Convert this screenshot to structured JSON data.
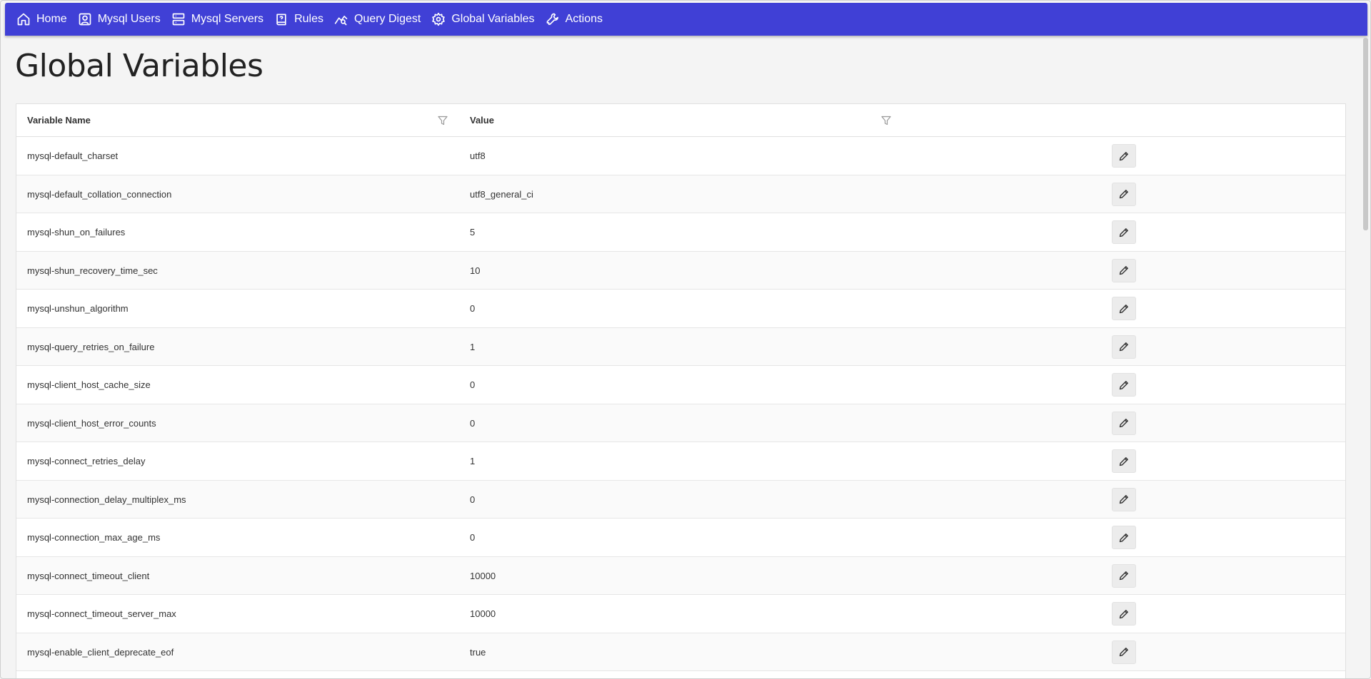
{
  "nav": {
    "items": [
      {
        "label": "Home",
        "icon": "home-icon"
      },
      {
        "label": "Mysql Users",
        "icon": "user-icon"
      },
      {
        "label": "Mysql Servers",
        "icon": "servers-icon"
      },
      {
        "label": "Rules",
        "icon": "rules-icon"
      },
      {
        "label": "Query Digest",
        "icon": "chart-icon"
      },
      {
        "label": "Global Variables",
        "icon": "gear-icon"
      },
      {
        "label": "Actions",
        "icon": "wrench-icon"
      }
    ]
  },
  "page": {
    "title": "Global Variables"
  },
  "table": {
    "columns": {
      "name": "Variable Name",
      "value": "Value"
    },
    "rows": [
      {
        "name": "mysql-default_charset",
        "value": "utf8"
      },
      {
        "name": "mysql-default_collation_connection",
        "value": "utf8_general_ci"
      },
      {
        "name": "mysql-shun_on_failures",
        "value": "5"
      },
      {
        "name": "mysql-shun_recovery_time_sec",
        "value": "10"
      },
      {
        "name": "mysql-unshun_algorithm",
        "value": "0"
      },
      {
        "name": "mysql-query_retries_on_failure",
        "value": "1"
      },
      {
        "name": "mysql-client_host_cache_size",
        "value": "0"
      },
      {
        "name": "mysql-client_host_error_counts",
        "value": "0"
      },
      {
        "name": "mysql-connect_retries_delay",
        "value": "1"
      },
      {
        "name": "mysql-connection_delay_multiplex_ms",
        "value": "0"
      },
      {
        "name": "mysql-connection_max_age_ms",
        "value": "0"
      },
      {
        "name": "mysql-connect_timeout_client",
        "value": "10000"
      },
      {
        "name": "mysql-connect_timeout_server_max",
        "value": "10000"
      },
      {
        "name": "mysql-enable_client_deprecate_eof",
        "value": "true"
      }
    ]
  },
  "colors": {
    "navbar": "#4040d6",
    "background": "#f4f4f4"
  }
}
